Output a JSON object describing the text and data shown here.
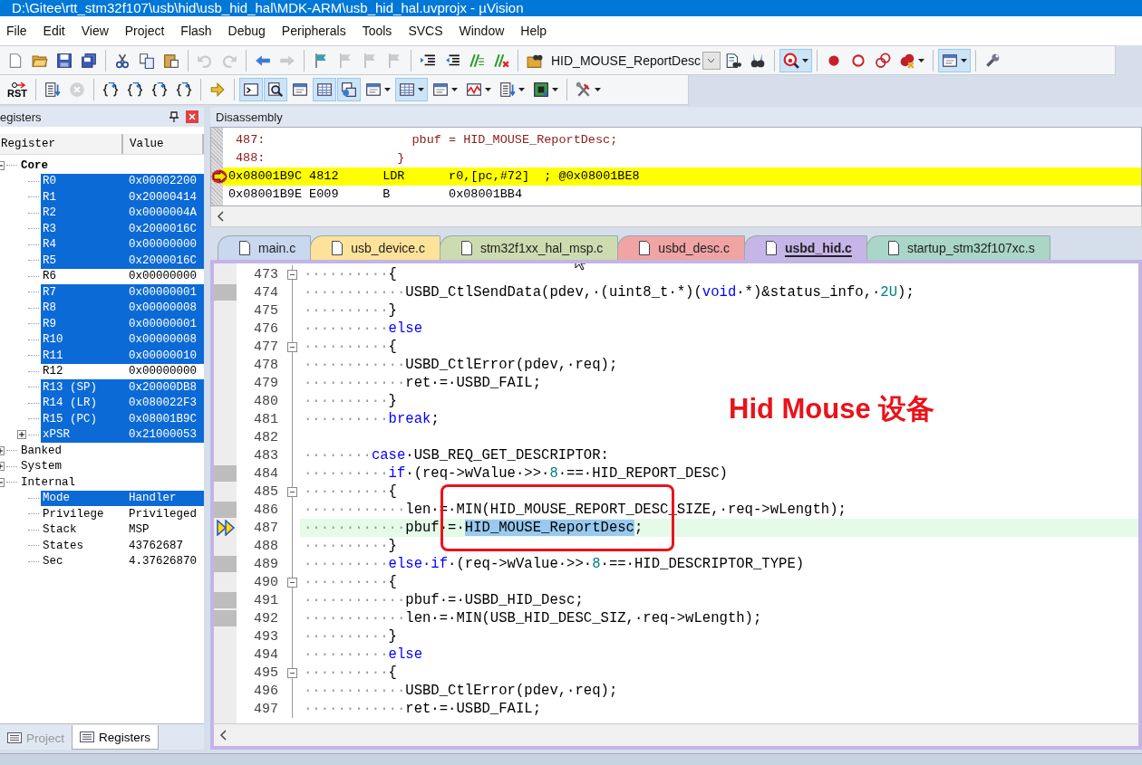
{
  "window": {
    "title": "D:\\Gitee\\rtt_stm32f107\\usb\\hid\\usb_hid_hal\\MDK-ARM\\usb_hid_hal.uvprojx - µVision"
  },
  "menu": [
    "File",
    "Edit",
    "View",
    "Project",
    "Flash",
    "Debug",
    "Peripherals",
    "Tools",
    "SVCS",
    "Window",
    "Help"
  ],
  "toolbars": [
    [
      {
        "kind": "new",
        "pressed": false,
        "disabled": false
      },
      {
        "kind": "open",
        "pressed": false,
        "disabled": false
      },
      {
        "kind": "save",
        "pressed": false,
        "disabled": false
      },
      {
        "kind": "saveall",
        "pressed": false,
        "disabled": false
      },
      {
        "kind": "sep"
      },
      {
        "kind": "cut",
        "pressed": false,
        "disabled": false
      },
      {
        "kind": "copy",
        "pressed": false,
        "disabled": false
      },
      {
        "kind": "paste",
        "pressed": false,
        "disabled": false
      },
      {
        "kind": "sep"
      },
      {
        "kind": "undo",
        "pressed": false,
        "disabled": true
      },
      {
        "kind": "redo",
        "pressed": false,
        "disabled": true
      },
      {
        "kind": "sep"
      },
      {
        "kind": "back",
        "pressed": false,
        "disabled": false
      },
      {
        "kind": "forward",
        "pressed": false,
        "disabled": true
      },
      {
        "kind": "sep"
      },
      {
        "kind": "flag",
        "pressed": false,
        "disabled": false
      },
      {
        "kind": "flag",
        "pressed": false,
        "disabled": true
      },
      {
        "kind": "flag",
        "pressed": false,
        "disabled": true
      },
      {
        "kind": "flag",
        "pressed": false,
        "disabled": true
      },
      {
        "kind": "sep"
      },
      {
        "kind": "indent",
        "pressed": false,
        "disabled": false
      },
      {
        "kind": "outdent",
        "pressed": false,
        "disabled": false
      },
      {
        "kind": "comment",
        "pressed": false,
        "disabled": false
      },
      {
        "kind": "uncomment",
        "pressed": false,
        "disabled": false
      },
      {
        "kind": "sep"
      },
      {
        "kind": "findfolder",
        "pressed": false,
        "disabled": false
      },
      {
        "kind": "combo",
        "value": "HID_MOUSE_ReportDesc"
      },
      {
        "kind": "finddoc",
        "pressed": false,
        "disabled": false
      },
      {
        "kind": "binoculars",
        "pressed": false,
        "disabled": false
      },
      {
        "kind": "sep"
      },
      {
        "kind": "debug",
        "pressed": true,
        "disabled": false,
        "dropdown": true
      },
      {
        "kind": "sep"
      },
      {
        "kind": "dot",
        "pressed": false,
        "disabled": false
      },
      {
        "kind": "ring",
        "pressed": false,
        "disabled": false
      },
      {
        "kind": "rings",
        "pressed": false,
        "disabled": false
      },
      {
        "kind": "dotsx",
        "pressed": false,
        "disabled": false,
        "dropdown": true
      },
      {
        "kind": "sep"
      },
      {
        "kind": "window",
        "pressed": true,
        "disabled": false,
        "dropdown": true
      },
      {
        "kind": "sep"
      },
      {
        "kind": "wrench",
        "pressed": false,
        "disabled": false
      }
    ],
    [
      {
        "kind": "rst",
        "label": "RST",
        "pressed": false,
        "disabled": false
      },
      {
        "kind": "sep"
      },
      {
        "kind": "list",
        "pressed": false,
        "disabled": false
      },
      {
        "kind": "stop",
        "pressed": false,
        "disabled": true
      },
      {
        "kind": "sep"
      },
      {
        "kind": "braces",
        "pressed": false,
        "disabled": false
      },
      {
        "kind": "braces",
        "pressed": false,
        "disabled": false
      },
      {
        "kind": "braces",
        "pressed": false,
        "disabled": false
      },
      {
        "kind": "braces",
        "pressed": false,
        "disabled": false
      },
      {
        "kind": "sep"
      },
      {
        "kind": "yarrow",
        "pressed": false,
        "disabled": false
      },
      {
        "kind": "sep"
      },
      {
        "kind": "terminal",
        "pressed": true,
        "disabled": false
      },
      {
        "kind": "magnifier",
        "pressed": true,
        "disabled": false
      },
      {
        "kind": "window",
        "pressed": false,
        "disabled": false
      },
      {
        "kind": "grid",
        "pressed": true,
        "disabled": false
      },
      {
        "kind": "windows",
        "pressed": true,
        "disabled": false
      },
      {
        "kind": "window",
        "pressed": false,
        "disabled": false,
        "dropdown": true
      },
      {
        "kind": "grid",
        "pressed": true,
        "disabled": false,
        "dropdown": true
      },
      {
        "kind": "window",
        "pressed": false,
        "disabled": false,
        "dropdown": true
      },
      {
        "kind": "wave",
        "pressed": false,
        "disabled": false,
        "dropdown": true
      },
      {
        "kind": "list",
        "pressed": false,
        "disabled": false,
        "dropdown": true
      },
      {
        "kind": "chip",
        "pressed": false,
        "disabled": false,
        "dropdown": true
      },
      {
        "kind": "sep"
      },
      {
        "kind": "tools",
        "pressed": false,
        "disabled": false,
        "dropdown": true
      }
    ]
  ],
  "registers": {
    "title": "egisters",
    "columns": [
      "Register",
      "Value"
    ],
    "tree": [
      {
        "label": "Core",
        "selected": false,
        "expanded": true,
        "children": [
          {
            "label": "R0",
            "value": "0x00002200",
            "selected": true
          },
          {
            "label": "R1",
            "value": "0x20000414",
            "selected": true
          },
          {
            "label": "R2",
            "value": "0x0000004A",
            "selected": true
          },
          {
            "label": "R3",
            "value": "0x2000016C",
            "selected": true
          },
          {
            "label": "R4",
            "value": "0x00000000",
            "selected": true
          },
          {
            "label": "R5",
            "value": "0x2000016C",
            "selected": true
          },
          {
            "label": "R6",
            "value": "0x00000000",
            "selected": false
          },
          {
            "label": "R7",
            "value": "0x00000001",
            "selected": true
          },
          {
            "label": "R8",
            "value": "0x00000008",
            "selected": true
          },
          {
            "label": "R9",
            "value": "0x00000001",
            "selected": true
          },
          {
            "label": "R10",
            "value": "0x00000008",
            "selected": true
          },
          {
            "label": "R11",
            "value": "0x00000010",
            "selected": true
          },
          {
            "label": "R12",
            "value": "0x00000000",
            "selected": false
          },
          {
            "label": "R13 (SP)",
            "value": "0x20000DB8",
            "selected": true
          },
          {
            "label": "R14 (LR)",
            "value": "0x080022F3",
            "selected": true
          },
          {
            "label": "R15 (PC)",
            "value": "0x08001B9C",
            "selected": true
          },
          {
            "label": "xPSR",
            "value": "0x21000053",
            "selected": true,
            "expanded": false
          }
        ]
      },
      {
        "label": "Banked",
        "selected": false,
        "expanded": false
      },
      {
        "label": "System",
        "selected": false,
        "expanded": false
      },
      {
        "label": "Internal",
        "selected": false,
        "expanded": true,
        "children": [
          {
            "label": "Mode",
            "value": "Handler",
            "selected": true
          },
          {
            "label": "Privilege",
            "value": "Privileged",
            "selected": false
          },
          {
            "label": "Stack",
            "value": "MSP",
            "selected": false
          },
          {
            "label": "States",
            "value": "43762687",
            "selected": false
          },
          {
            "label": "Sec",
            "value": "4.37626870",
            "selected": false
          }
        ]
      }
    ]
  },
  "panel_tabs": [
    {
      "label": "Project",
      "selected": false
    },
    {
      "label": "Registers",
      "selected": true
    }
  ],
  "disassembly": {
    "title": "Disassembly",
    "lines": [
      {
        "kind": "source",
        "current": false,
        "text": "487:                    pbuf = HID_MOUSE_ReportDesc;"
      },
      {
        "kind": "source",
        "current": false,
        "text": "488:                  }"
      },
      {
        "kind": "asm",
        "current": true,
        "text": "0x08001B9C 4812      LDR      r0,[pc,#72]  ; @0x08001BE8"
      },
      {
        "kind": "asm",
        "current": false,
        "text": "0x08001B9E E009      B        0x08001BB4"
      }
    ]
  },
  "editor": {
    "tabs": [
      {
        "label": "main.c",
        "color": "#c9d7ef",
        "selected": false
      },
      {
        "label": "usb_device.c",
        "color": "#fde39a",
        "selected": false
      },
      {
        "label": "stm32f1xx_hal_msp.c",
        "color": "#cddbb0",
        "selected": false
      },
      {
        "label": "usbd_desc.c",
        "color": "#f0a4a4",
        "selected": false
      },
      {
        "label": "usbd_hid.c",
        "color": "#c6b6e8",
        "selected": true
      },
      {
        "label": "startup_stm32f107xc.s",
        "color": "#a9d6c6",
        "selected": false
      }
    ],
    "lines": [
      {
        "number": "473",
        "foldable": true,
        "marked": false,
        "current": false,
        "indent": "··········",
        "tokens": [
          {
            "kind": "text",
            "text": "{"
          }
        ]
      },
      {
        "number": "474",
        "foldable": false,
        "marked": true,
        "current": false,
        "indent": "············",
        "tokens": [
          {
            "kind": "text",
            "text": "USBD_CtlSendData(pdev,·(uint8_t·*)("
          },
          {
            "kind": "keyword",
            "text": "void"
          },
          {
            "kind": "text",
            "text": "·*)&status_info,·"
          },
          {
            "kind": "number",
            "text": "2U"
          },
          {
            "kind": "text",
            "text": ");"
          }
        ]
      },
      {
        "number": "475",
        "foldable": false,
        "marked": false,
        "current": false,
        "indent": "··········",
        "tokens": [
          {
            "kind": "text",
            "text": "}"
          }
        ]
      },
      {
        "number": "476",
        "foldable": false,
        "marked": false,
        "current": false,
        "indent": "··········",
        "tokens": [
          {
            "kind": "keyword",
            "text": "else"
          }
        ]
      },
      {
        "number": "477",
        "foldable": true,
        "marked": false,
        "current": false,
        "indent": "··········",
        "tokens": [
          {
            "kind": "text",
            "text": "{"
          }
        ]
      },
      {
        "number": "478",
        "foldable": false,
        "marked": false,
        "current": false,
        "indent": "············",
        "tokens": [
          {
            "kind": "text",
            "text": "USBD_CtlError(pdev,·req);"
          }
        ]
      },
      {
        "number": "479",
        "foldable": false,
        "marked": false,
        "current": false,
        "indent": "············",
        "tokens": [
          {
            "kind": "text",
            "text": "ret·=·USBD_FAIL;"
          }
        ]
      },
      {
        "number": "480",
        "foldable": false,
        "marked": false,
        "current": false,
        "indent": "··········",
        "tokens": [
          {
            "kind": "text",
            "text": "}"
          }
        ]
      },
      {
        "number": "481",
        "foldable": false,
        "marked": false,
        "current": false,
        "indent": "··········",
        "tokens": [
          {
            "kind": "keyword",
            "text": "break"
          },
          {
            "kind": "text",
            "text": ";"
          }
        ]
      },
      {
        "number": "482",
        "foldable": false,
        "marked": false,
        "current": false
      },
      {
        "number": "483",
        "foldable": false,
        "marked": false,
        "current": false,
        "indent": "········",
        "tokens": [
          {
            "kind": "keyword",
            "text": "case"
          },
          {
            "kind": "text",
            "text": "·USB_REQ_GET_DESCRIPTOR:"
          }
        ]
      },
      {
        "number": "484",
        "foldable": false,
        "marked": true,
        "current": false,
        "indent": "··········",
        "tokens": [
          {
            "kind": "keyword",
            "text": "if"
          },
          {
            "kind": "text",
            "text": "·(req->wValue·>>·"
          },
          {
            "kind": "number",
            "text": "8"
          },
          {
            "kind": "text",
            "text": "·==·HID_REPORT_DESC)"
          }
        ]
      },
      {
        "number": "485",
        "foldable": true,
        "marked": false,
        "current": false,
        "indent": "··········",
        "tokens": [
          {
            "kind": "text",
            "text": "{"
          }
        ]
      },
      {
        "number": "486",
        "foldable": false,
        "marked": true,
        "current": false,
        "indent": "············",
        "tokens": [
          {
            "kind": "text",
            "text": "len·=·MIN(HID_MOUSE_REPORT_DESC_SIZE,·req->wLength);"
          }
        ]
      },
      {
        "number": "487",
        "foldable": false,
        "marked": false,
        "current": true,
        "indent": "············",
        "tokens": [
          {
            "kind": "text",
            "text": "pbuf·=·"
          },
          {
            "kind": "selection",
            "text": "HID_MOUSE_ReportDesc"
          },
          {
            "kind": "text",
            "text": ";"
          }
        ]
      },
      {
        "number": "488",
        "foldable": false,
        "marked": false,
        "current": false,
        "indent": "··········",
        "tokens": [
          {
            "kind": "text",
            "text": "}"
          }
        ]
      },
      {
        "number": "489",
        "foldable": false,
        "marked": true,
        "current": false,
        "indent": "··········",
        "tokens": [
          {
            "kind": "keyword",
            "text": "else·if"
          },
          {
            "kind": "text",
            "text": "·(req->wValue·>>·"
          },
          {
            "kind": "number",
            "text": "8"
          },
          {
            "kind": "text",
            "text": "·==·HID_DESCRIPTOR_TYPE)"
          }
        ]
      },
      {
        "number": "490",
        "foldable": true,
        "marked": false,
        "current": false,
        "indent": "··········",
        "tokens": [
          {
            "kind": "text",
            "text": "{"
          }
        ]
      },
      {
        "number": "491",
        "foldable": false,
        "marked": true,
        "current": false,
        "indent": "············",
        "tokens": [
          {
            "kind": "text",
            "text": "pbuf·=·USBD_HID_Desc;"
          }
        ]
      },
      {
        "number": "492",
        "foldable": false,
        "marked": true,
        "current": false,
        "indent": "············",
        "tokens": [
          {
            "kind": "text",
            "text": "len·=·MIN(USB_HID_DESC_SIZ,·req->wLength);"
          }
        ]
      },
      {
        "number": "493",
        "foldable": false,
        "marked": false,
        "current": false,
        "indent": "··········",
        "tokens": [
          {
            "kind": "text",
            "text": "}"
          }
        ]
      },
      {
        "number": "494",
        "foldable": false,
        "marked": false,
        "current": false,
        "indent": "··········",
        "tokens": [
          {
            "kind": "keyword",
            "text": "else"
          }
        ]
      },
      {
        "number": "495",
        "foldable": true,
        "marked": false,
        "current": false,
        "indent": "··········",
        "tokens": [
          {
            "kind": "text",
            "text": "{"
          }
        ]
      },
      {
        "number": "496",
        "foldable": false,
        "marked": false,
        "current": false,
        "indent": "············",
        "tokens": [
          {
            "kind": "text",
            "text": "USBD_CtlError(pdev,·req);"
          }
        ]
      },
      {
        "number": "497",
        "foldable": false,
        "marked": false,
        "current": false,
        "indent": "············",
        "tokens": [
          {
            "kind": "text",
            "text": "ret·=·USBD_FAIL;"
          }
        ]
      }
    ],
    "annotation": {
      "text": "Hid Mouse 设备"
    }
  }
}
